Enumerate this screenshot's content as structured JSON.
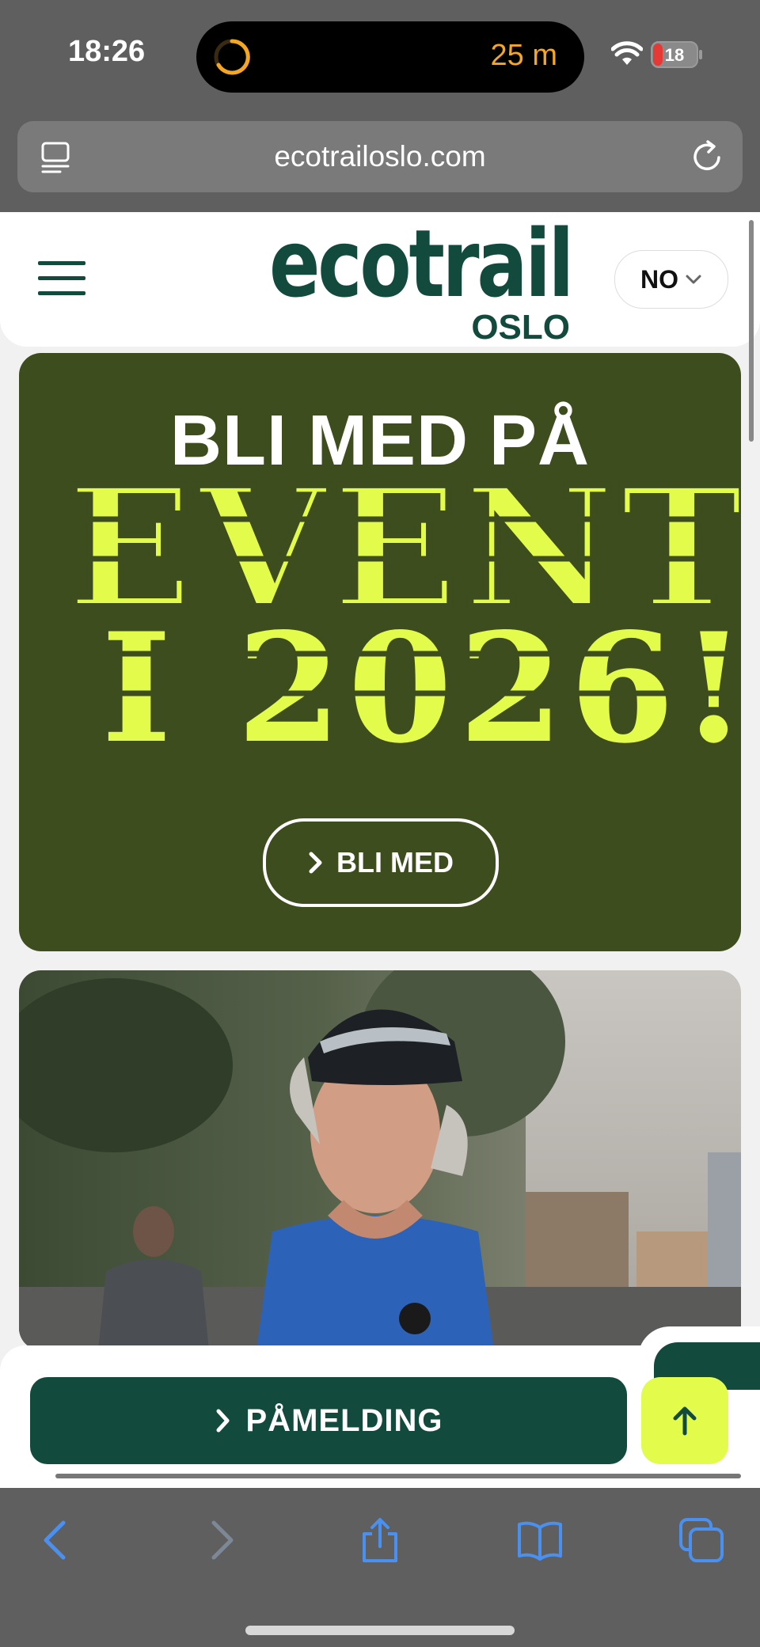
{
  "status_bar": {
    "time": "18:26",
    "activity_minutes": "25 m",
    "battery_level": "18"
  },
  "browser": {
    "url": "ecotrailoslo.com"
  },
  "header": {
    "logo_main": "ecotrail",
    "logo_sub": "OSLO",
    "language": "NO"
  },
  "hero": {
    "line1": "BLI MED PÅ",
    "line2": "EVENTYR",
    "line3": "I 2026!",
    "button_label": "BLI MED",
    "background_color": "#3d4d1d",
    "accent_color": "#e3fb4b"
  },
  "sticky_bar": {
    "register_label": "PÅMELDING",
    "up_icon": "arrow-up-icon"
  },
  "colors": {
    "brand_green": "#134a3e",
    "lime": "#e3fb4b"
  }
}
